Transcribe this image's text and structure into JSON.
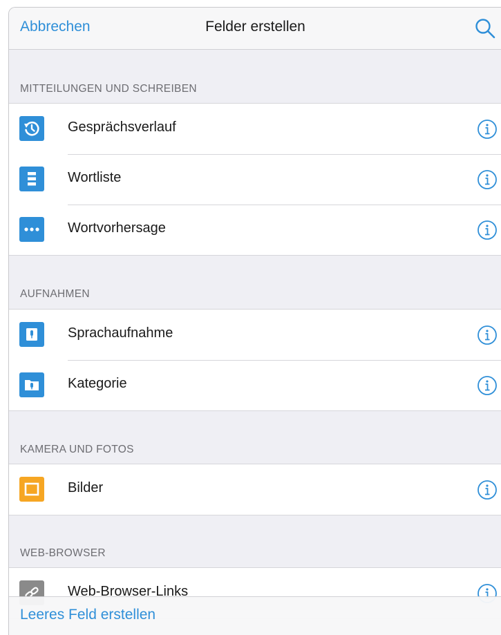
{
  "navbar": {
    "cancel_label": "Abbrechen",
    "title": "Felder erstellen",
    "search_icon": "search-icon"
  },
  "sections": [
    {
      "header": "MITTEILUNGEN UND SCHREIBEN",
      "items": [
        {
          "label": "Gesprächsverlauf",
          "icon": "history-icon"
        },
        {
          "label": "Wortliste",
          "icon": "word-list-icon"
        },
        {
          "label": "Wortvorhersage",
          "icon": "ellipsis-icon"
        }
      ]
    },
    {
      "header": "AUFNAHMEN",
      "items": [
        {
          "label": "Sprachaufnahme",
          "icon": "voice-recording-icon"
        },
        {
          "label": "Kategorie",
          "icon": "folder-microphone-icon"
        }
      ]
    },
    {
      "header": "KAMERA UND FOTOS",
      "items": [
        {
          "label": "Bilder",
          "icon": "picture-icon"
        }
      ]
    },
    {
      "header": "WEB-BROWSER",
      "items": [
        {
          "label": "Web-Browser-Links",
          "icon": "link-icon"
        }
      ]
    }
  ],
  "bottom_bar": {
    "create_empty_label": "Leeres Feld erstellen"
  },
  "colors": {
    "accent": "#2f8fd8",
    "orange": "#f6a623",
    "gray_icon": "#8a8a8a",
    "background": "#efeff4"
  }
}
